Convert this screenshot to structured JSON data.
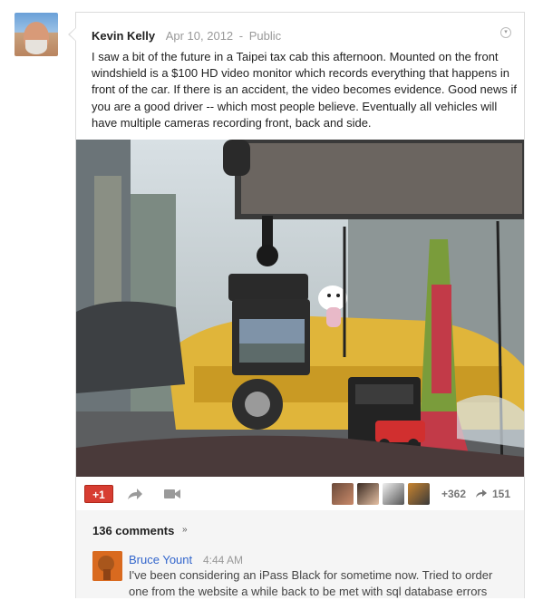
{
  "post": {
    "author": "Kevin Kelly",
    "date": "Apr 10, 2012",
    "separator": "-",
    "privacy": "Public",
    "text": "I saw a bit of the future in a Taipei tax cab this afternoon. Mounted on the front windshield is a $100 HD video monitor which records everything that happens in front of the car. If there is an accident, the video becomes evidence. Good news if you are a good driver -- which most people believe. Eventually all vehicles will have multiple cameras recording front, back and side."
  },
  "actions": {
    "plusone_label": "+1",
    "plus_count": "+362",
    "reshare_count": "151"
  },
  "comments": {
    "count_label": "136 comments",
    "items": [
      {
        "author": "Bruce Yount",
        "time": "4:44 AM",
        "text": "I've been considering an iPass Black for sometime now. Tried to order one from the website a while back to be met with sql database errors"
      }
    ]
  },
  "icons": {
    "menu": "chevron-down-icon",
    "share": "share-icon",
    "hangout": "video-camera-icon",
    "reshare": "reshare-arrow-icon",
    "expand": "double-chevron-down-icon"
  },
  "colors": {
    "plusone": "#d73d32",
    "link": "#3366cc",
    "muted": "#999999"
  }
}
